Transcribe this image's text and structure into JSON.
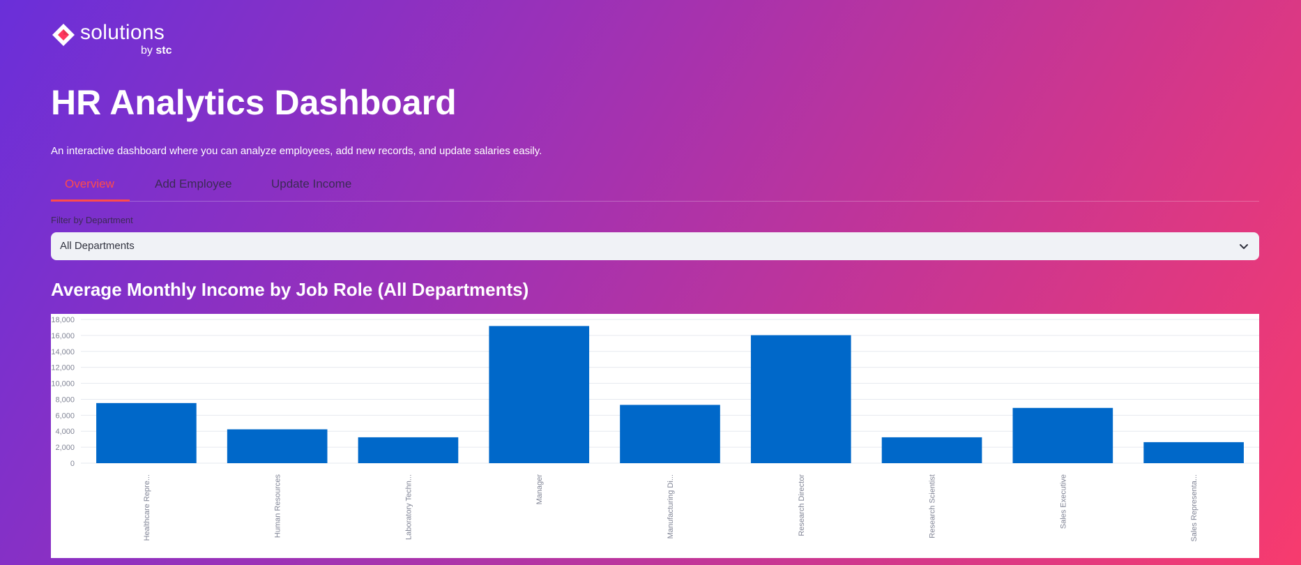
{
  "brand": {
    "name": "solutions",
    "by": "by",
    "company": "stc"
  },
  "header": {
    "title": "HR Analytics Dashboard",
    "subtitle": "An interactive dashboard where you can analyze employees, add new records, and update salaries easily."
  },
  "tabs": [
    {
      "label": "Overview",
      "active": true
    },
    {
      "label": "Add Employee",
      "active": false
    },
    {
      "label": "Update Income",
      "active": false
    }
  ],
  "filter": {
    "label": "Filter by Department",
    "selected": "All Departments"
  },
  "chart_title": "Average Monthly Income by Job Role (All Departments)",
  "colors": {
    "accent": "#ff4b4b",
    "bar": "#0068c9",
    "select_bg": "#f0f2f6"
  },
  "chart_data": {
    "type": "bar",
    "categories": [
      "Healthcare Repre...",
      "Human Resources",
      "Laboratory Techn...",
      "Manager",
      "Manufacturing Di...",
      "Research Director",
      "Research Scientist",
      "Sales Executive",
      "Sales Representa..."
    ],
    "values": [
      7530,
      4240,
      3240,
      17180,
      7300,
      16030,
      3240,
      6920,
      2630
    ],
    "yticks": [
      0,
      2000,
      4000,
      6000,
      8000,
      10000,
      12000,
      14000,
      16000,
      18000
    ],
    "ylim": [
      0,
      18000
    ],
    "grid": true
  }
}
